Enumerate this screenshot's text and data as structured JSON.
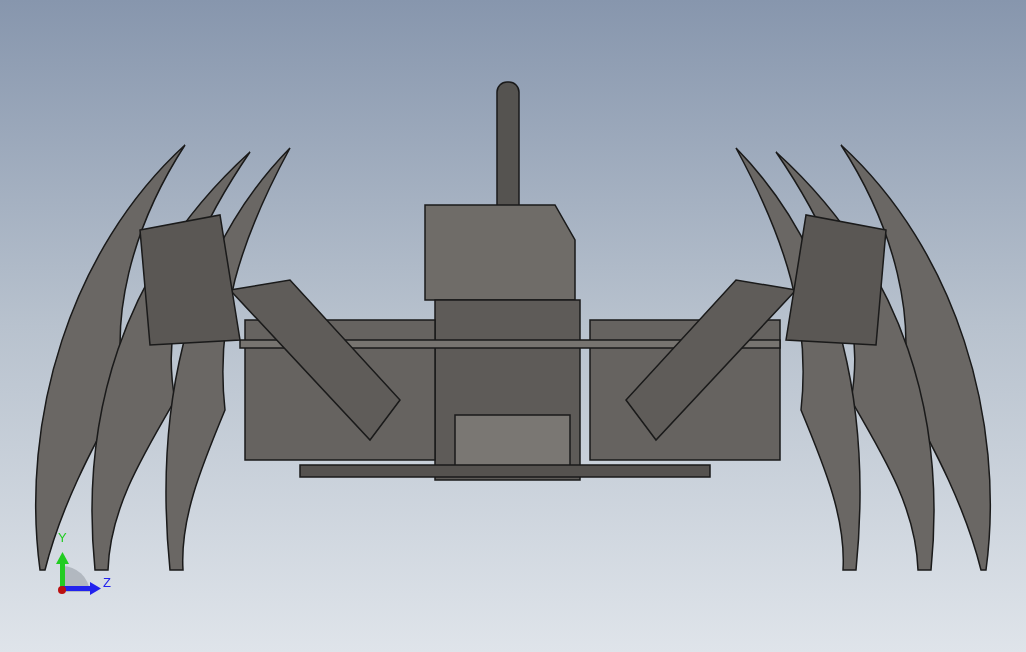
{
  "viewport": {
    "triad": {
      "axes": [
        {
          "label": "Y",
          "color": "#22cc22"
        },
        {
          "label": "Z",
          "color": "#2222ee"
        }
      ]
    }
  }
}
